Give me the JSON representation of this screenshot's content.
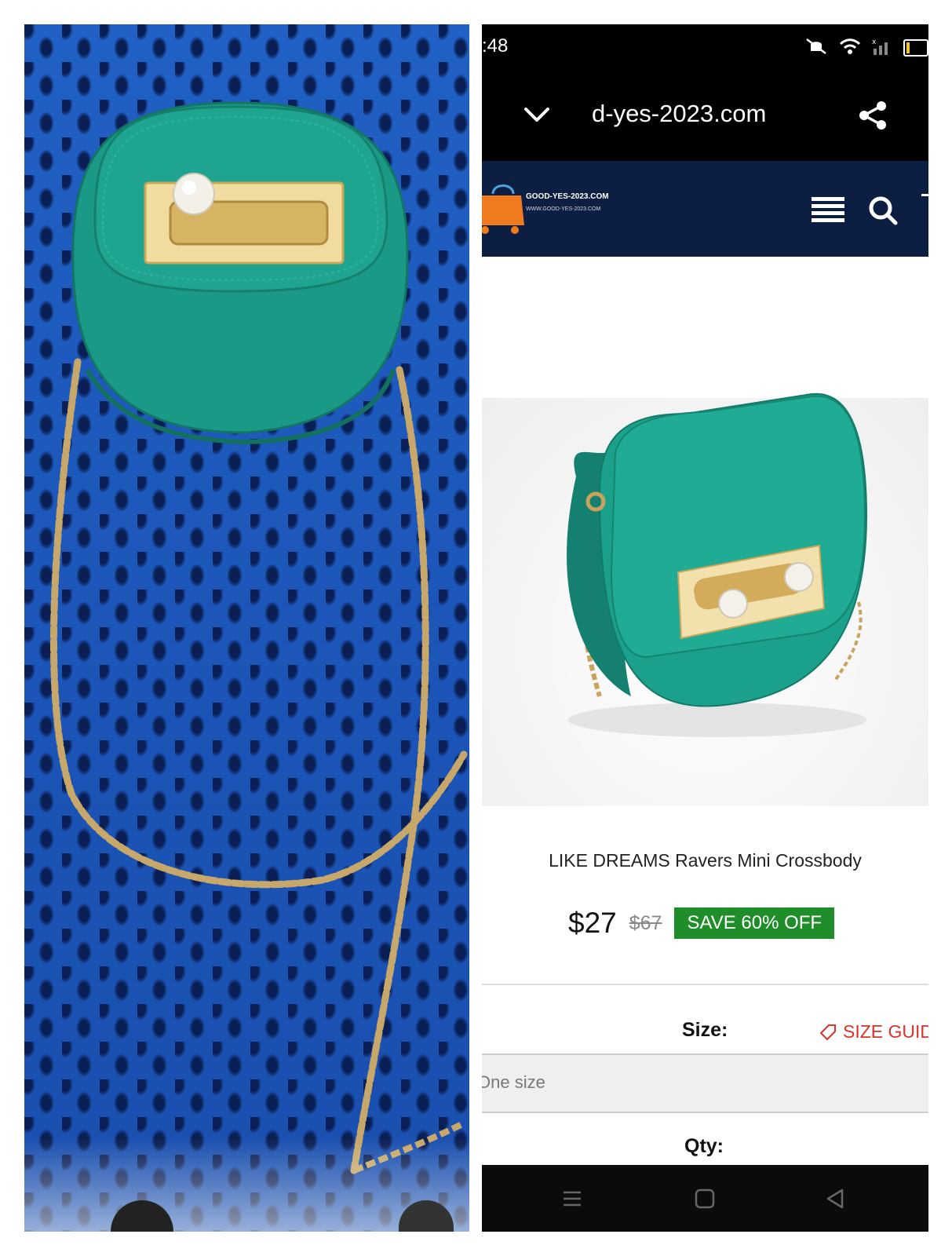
{
  "statusbar": {
    "time": ":48"
  },
  "browser": {
    "url": "d-yes-2023.com"
  },
  "site": {
    "logo_name": "GOOD-YES-2023.COM",
    "logo_url": "WWW.GOOD-YES-2023.COM"
  },
  "product": {
    "title": "LIKE DREAMS Ravers Mini Crossbody",
    "price": "$27",
    "original_price": "$67",
    "save_badge": "SAVE 60% OFF",
    "size_label": "Size:",
    "size_guide": "SIZE GUID",
    "size_value": "One size",
    "qty_label": "Qty:"
  },
  "colors": {
    "sweater_blue": "#1a55b8",
    "bag_teal": "#1a9a86",
    "header_navy": "#0c1e42",
    "badge_green": "#1f8d2a",
    "size_guide_red": "#d9342b"
  },
  "icons": {
    "status": [
      "mute-icon",
      "wifi-icon",
      "signal-icon",
      "battery-icon"
    ],
    "browser": [
      "chevron-down-icon",
      "share-icon"
    ],
    "header": [
      "menu-icon",
      "search-icon"
    ],
    "nav": [
      "recent-apps-icon",
      "home-icon",
      "back-icon"
    ]
  }
}
